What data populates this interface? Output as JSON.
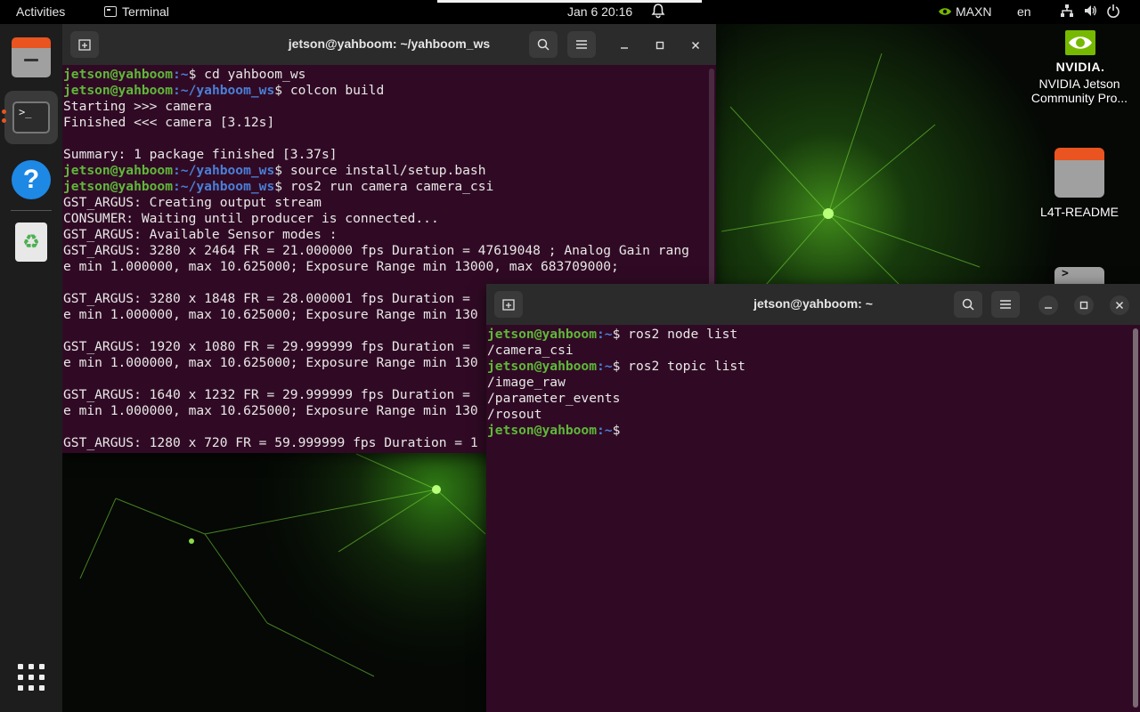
{
  "topbar": {
    "activities": "Activities",
    "app_name": "Terminal",
    "clock": "Jan 6  20:16",
    "power_mode": "MAXN",
    "language": "en"
  },
  "dock": {
    "items": [
      "files-icon",
      "terminal-icon",
      "help-icon",
      "trash-icon"
    ],
    "show_apps": "grid-icon"
  },
  "desktop": {
    "nvidia_wordmark": "NVIDIA.",
    "icon1_label": "NVIDIA Jetson Community Pro...",
    "icon2_label": "L4T-README",
    "icon3_label": ">"
  },
  "window1": {
    "title": "jetson@yahboom: ~/yahboom_ws",
    "lines": [
      {
        "user": "jetson@yahboom",
        "path": ":~",
        "cmd": "$ cd yahboom_ws"
      },
      {
        "user": "jetson@yahboom",
        "path": ":~/yahboom_ws",
        "cmd": "$ colcon build"
      },
      {
        "text": "Starting >>> camera"
      },
      {
        "text": "Finished <<< camera [3.12s]"
      },
      {
        "text": ""
      },
      {
        "text": "Summary: 1 package finished [3.37s]"
      },
      {
        "user": "jetson@yahboom",
        "path": ":~/yahboom_ws",
        "cmd": "$ source install/setup.bash"
      },
      {
        "user": "jetson@yahboom",
        "path": ":~/yahboom_ws",
        "cmd": "$ ros2 run camera camera_csi"
      },
      {
        "text": "GST_ARGUS: Creating output stream"
      },
      {
        "text": "CONSUMER: Waiting until producer is connected..."
      },
      {
        "text": "GST_ARGUS: Available Sensor modes :"
      },
      {
        "text": "GST_ARGUS: 3280 x 2464 FR = 21.000000 fps Duration = 47619048 ; Analog Gain rang"
      },
      {
        "text": "e min 1.000000, max 10.625000; Exposure Range min 13000, max 683709000;"
      },
      {
        "text": ""
      },
      {
        "text": "GST_ARGUS: 3280 x 1848 FR = 28.000001 fps Duration = "
      },
      {
        "text": "e min 1.000000, max 10.625000; Exposure Range min 130"
      },
      {
        "text": ""
      },
      {
        "text": "GST_ARGUS: 1920 x 1080 FR = 29.999999 fps Duration = "
      },
      {
        "text": "e min 1.000000, max 10.625000; Exposure Range min 130"
      },
      {
        "text": ""
      },
      {
        "text": "GST_ARGUS: 1640 x 1232 FR = 29.999999 fps Duration = "
      },
      {
        "text": "e min 1.000000, max 10.625000; Exposure Range min 130"
      },
      {
        "text": ""
      },
      {
        "text": "GST_ARGUS: 1280 x 720 FR = 59.999999 fps Duration = 1"
      }
    ]
  },
  "window2": {
    "title": "jetson@yahboom: ~",
    "lines": [
      {
        "user": "jetson@yahboom",
        "path": ":~",
        "cmd": "$ ros2 node list"
      },
      {
        "text": "/camera_csi"
      },
      {
        "user": "jetson@yahboom",
        "path": ":~",
        "cmd": "$ ros2 topic list"
      },
      {
        "text": "/image_raw"
      },
      {
        "text": "/parameter_events"
      },
      {
        "text": "/rosout"
      },
      {
        "user": "jetson@yahboom",
        "path": ":~",
        "cmd": "$ "
      }
    ]
  },
  "colors": {
    "terminal_bg": "#300a24",
    "prompt_user": "#5fb83a",
    "prompt_path": "#4a7fd8",
    "accent": "#e95420",
    "nvidia_green": "#76b900"
  }
}
